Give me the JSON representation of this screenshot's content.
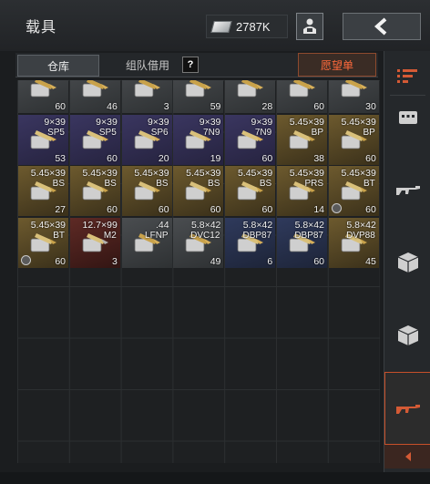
{
  "header": {
    "title": "载具",
    "money": "2787K"
  },
  "tabs": {
    "warehouse": "仓库",
    "team_borrow": "组队借用",
    "help": "?",
    "wishlist": "愿望单"
  },
  "inventory": {
    "rows": [
      [
        {
          "rarity": "plain",
          "caliber": "",
          "type": "",
          "qty": "60",
          "mark": false
        },
        {
          "rarity": "plain",
          "caliber": "",
          "type": "",
          "qty": "46",
          "mark": false
        },
        {
          "rarity": "plain",
          "caliber": "",
          "type": "",
          "qty": "3",
          "mark": false
        },
        {
          "rarity": "plain",
          "caliber": "",
          "type": "",
          "qty": "59",
          "mark": false
        },
        {
          "rarity": "plain",
          "caliber": "",
          "type": "",
          "qty": "28",
          "mark": false
        },
        {
          "rarity": "plain",
          "caliber": "",
          "type": "",
          "qty": "60",
          "mark": false
        },
        {
          "rarity": "plain",
          "caliber": "",
          "type": "",
          "qty": "30",
          "mark": false
        }
      ],
      [
        {
          "rarity": "purple",
          "caliber": "9×39",
          "type": "SP5",
          "qty": "53",
          "mark": false
        },
        {
          "rarity": "purple",
          "caliber": "9×39",
          "type": "SP5",
          "qty": "60",
          "mark": false
        },
        {
          "rarity": "purple",
          "caliber": "9×39",
          "type": "SP6",
          "qty": "20",
          "mark": false
        },
        {
          "rarity": "purple",
          "caliber": "9×39",
          "type": "7N9",
          "qty": "19",
          "mark": false
        },
        {
          "rarity": "purple",
          "caliber": "9×39",
          "type": "7N9",
          "qty": "60",
          "mark": false
        },
        {
          "rarity": "gold",
          "caliber": "5.45×39",
          "type": "BP",
          "qty": "38",
          "mark": false
        },
        {
          "rarity": "gold",
          "caliber": "5.45×39",
          "type": "BP",
          "qty": "60",
          "mark": false
        }
      ],
      [
        {
          "rarity": "gold",
          "caliber": "5.45×39",
          "type": "BS",
          "qty": "27",
          "mark": false
        },
        {
          "rarity": "gold",
          "caliber": "5.45×39",
          "type": "BS",
          "qty": "60",
          "mark": false
        },
        {
          "rarity": "gold",
          "caliber": "5.45×39",
          "type": "BS",
          "qty": "60",
          "mark": false
        },
        {
          "rarity": "gold",
          "caliber": "5.45×39",
          "type": "BS",
          "qty": "60",
          "mark": false
        },
        {
          "rarity": "gold",
          "caliber": "5.45×39",
          "type": "BS",
          "qty": "60",
          "mark": false
        },
        {
          "rarity": "gold",
          "caliber": "5.45×39",
          "type": "PRS",
          "qty": "14",
          "mark": false
        },
        {
          "rarity": "gold",
          "caliber": "5.45×39",
          "type": "BT",
          "qty": "60",
          "mark": true
        }
      ],
      [
        {
          "rarity": "gold",
          "caliber": "5.45×39",
          "type": "BT",
          "qty": "60",
          "mark": true
        },
        {
          "rarity": "red",
          "caliber": "12.7×99",
          "type": "M2",
          "qty": "3",
          "mark": false
        },
        {
          "rarity": "plain",
          "caliber": ".44",
          "type": "LFNP",
          "qty": "",
          "mark": false
        },
        {
          "rarity": "plain",
          "caliber": "5.8×42",
          "type": "DVC12",
          "qty": "49",
          "mark": false
        },
        {
          "rarity": "blue",
          "caliber": "5.8×42",
          "type": "DBP87",
          "qty": "6",
          "mark": false
        },
        {
          "rarity": "blue",
          "caliber": "5.8×42",
          "type": "DBP87",
          "qty": "60",
          "mark": false
        },
        {
          "rarity": "gold",
          "caliber": "5.8×42",
          "type": "DVP88",
          "qty": "45",
          "mark": false
        }
      ]
    ]
  },
  "sidebar": {
    "items": [
      "filter-icon",
      "vest-icon",
      "rifle-icon",
      "box-icon",
      "box-icon",
      "rifle-icon-active"
    ],
    "active_color": "#c8502a"
  }
}
